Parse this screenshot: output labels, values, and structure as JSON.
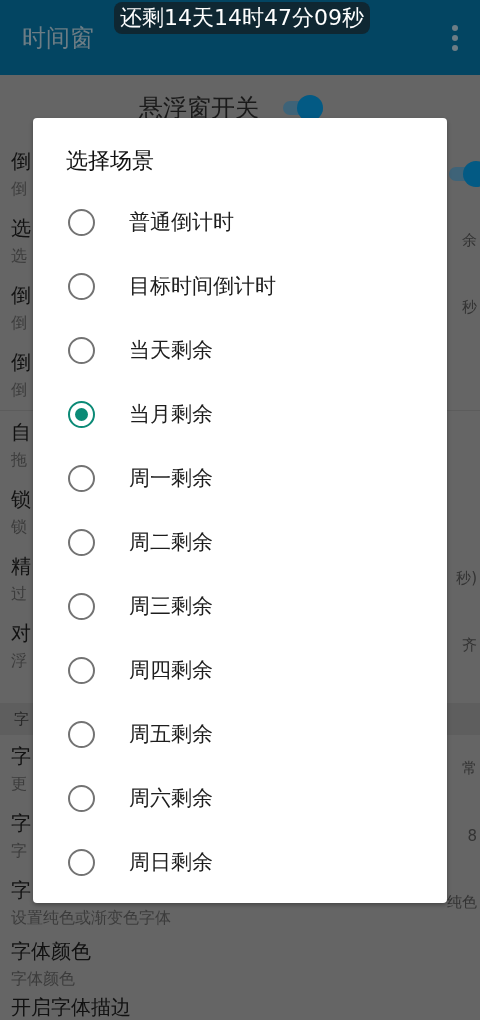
{
  "floating_timer": {
    "text": "还剩14天14时47分09秒"
  },
  "app_bar": {
    "title": "时间窗"
  },
  "master_switch": {
    "label": "悬浮窗开关",
    "on": true
  },
  "settings": [
    {
      "kind": "row",
      "title": "倒",
      "subtitle": "倒",
      "toggle": {
        "on": true
      }
    },
    {
      "kind": "row",
      "title": "选",
      "subtitle": "选",
      "value": "余"
    },
    {
      "kind": "row",
      "title": "倒",
      "subtitle": "倒",
      "value": "秒"
    },
    {
      "kind": "row",
      "title": "倒",
      "subtitle": "倒"
    },
    {
      "kind": "divider"
    },
    {
      "kind": "row",
      "title": "自",
      "subtitle": "拖"
    },
    {
      "kind": "row",
      "title": "锁",
      "subtitle": "锁"
    },
    {
      "kind": "row",
      "title": "精",
      "subtitle": "过",
      "value": "秒)"
    },
    {
      "kind": "row",
      "title": "对",
      "subtitle": "浮",
      "value": "齐"
    },
    {
      "kind": "header",
      "title": "字"
    },
    {
      "kind": "row",
      "title": "字",
      "subtitle": "更",
      "value": "常"
    },
    {
      "kind": "row",
      "title": "字",
      "subtitle": "字",
      "value": "8"
    },
    {
      "kind": "row",
      "title": "字",
      "subtitle": "设置纯色或渐变色字体",
      "value": "纯色"
    },
    {
      "kind": "row",
      "title": "字体颜色",
      "subtitle": "字体颜色"
    },
    {
      "kind": "row",
      "title": "开启字体描边"
    }
  ],
  "dialog": {
    "title": "选择场景",
    "options": [
      {
        "label": "普通倒计时",
        "selected": false
      },
      {
        "label": "目标时间倒计时",
        "selected": false
      },
      {
        "label": "当天剩余",
        "selected": false
      },
      {
        "label": "当月剩余",
        "selected": true
      },
      {
        "label": "周一剩余",
        "selected": false
      },
      {
        "label": "周二剩余",
        "selected": false
      },
      {
        "label": "周三剩余",
        "selected": false
      },
      {
        "label": "周四剩余",
        "selected": false
      },
      {
        "label": "周五剩余",
        "selected": false
      },
      {
        "label": "周六剩余",
        "selected": false
      },
      {
        "label": "周日剩余",
        "selected": false
      }
    ]
  }
}
